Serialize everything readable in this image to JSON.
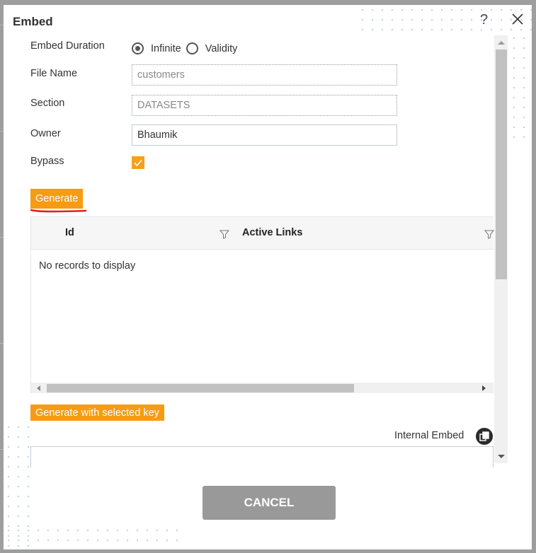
{
  "dialog": {
    "title": "Embed",
    "help_icon": "question-mark-icon",
    "close_icon": "close-icon"
  },
  "form": {
    "embed_duration": {
      "label": "Embed Duration",
      "options": [
        {
          "label": "Infinite",
          "checked": true
        },
        {
          "label": "Validity",
          "checked": false
        }
      ]
    },
    "file_name": {
      "label": "File Name",
      "value": "customers"
    },
    "section": {
      "label": "Section",
      "value": "DATASETS"
    },
    "owner": {
      "label": "Owner",
      "value": "Bhaumik"
    },
    "bypass": {
      "label": "Bypass",
      "checked": true
    }
  },
  "buttons": {
    "generate": "Generate",
    "generate_with_key": "Generate with selected key",
    "cancel": "CANCEL"
  },
  "grid": {
    "columns": [
      {
        "label": "Id",
        "filter_icon": "filter-icon"
      },
      {
        "label": "Active Links",
        "filter_icon": "filter-icon"
      }
    ],
    "empty_message": "No records to display",
    "rows": []
  },
  "internal_embed": {
    "label": "Internal Embed",
    "copy_icon": "copy-icon",
    "value": ""
  },
  "colors": {
    "accent": "#f79b12",
    "cancel": "#999999",
    "annotation": "#e0201e"
  }
}
